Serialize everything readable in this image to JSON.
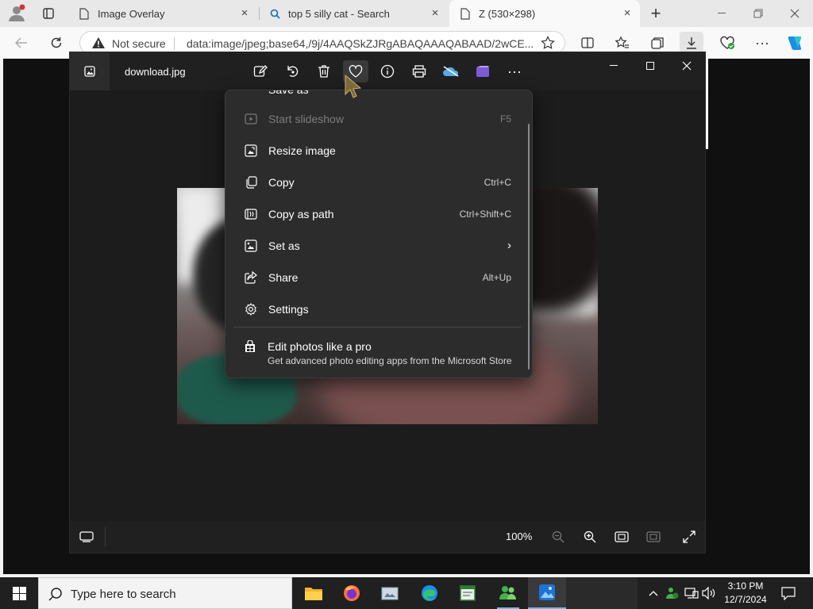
{
  "browser": {
    "tabs": [
      {
        "title": "Image Overlay",
        "icon": "page-icon",
        "active": false
      },
      {
        "title": "top 5 silly cat - Search",
        "icon": "search-icon",
        "active": false
      },
      {
        "title": "Z (530×298)",
        "icon": "page-icon",
        "active": true
      }
    ],
    "new_tab_symbol": "+",
    "address": {
      "security_label": "Not secure",
      "url": "data:image/jpeg;base64,/9j/4AAQSkZJRgABAQAAAQABAAD/2wCE..."
    }
  },
  "photos": {
    "file_name": "download.jpg",
    "toolbar_icons": [
      "edit-icon",
      "rotate-icon",
      "delete-icon",
      "favorite-icon",
      "info-icon",
      "print-icon",
      "onedrive-icon",
      "clipchamp-icon",
      "more-icon"
    ],
    "zoom": "100%",
    "menu": {
      "clipped_item": "Save as",
      "items": [
        {
          "label": "Start slideshow",
          "shortcut": "F5",
          "icon": "slideshow-icon",
          "disabled": true
        },
        {
          "label": "Resize image",
          "shortcut": "",
          "icon": "resize-icon",
          "disabled": false
        },
        {
          "label": "Copy",
          "shortcut": "Ctrl+C",
          "icon": "copy-icon",
          "disabled": false
        },
        {
          "label": "Copy as path",
          "shortcut": "Ctrl+Shift+C",
          "icon": "copy-path-icon",
          "disabled": false
        },
        {
          "label": "Set as",
          "shortcut": "",
          "icon": "set-as-icon",
          "disabled": false,
          "submenu": true
        },
        {
          "label": "Share",
          "shortcut": "Alt+Up",
          "icon": "share-icon",
          "disabled": false
        },
        {
          "label": "Settings",
          "shortcut": "",
          "icon": "settings-icon",
          "disabled": false
        }
      ],
      "promo_title": "Edit photos like a pro",
      "promo_subtitle": "Get advanced photo editing apps from the Microsoft Store"
    }
  },
  "taskbar": {
    "search_placeholder": "Type here to search",
    "time": "3:10 PM",
    "date": "12/7/2024"
  },
  "colors": {
    "accent": "#0f6cbd",
    "photos_bg": "#1c1c1c",
    "menu_bg": "#2c2c2c",
    "taskbar_bg": "#202020"
  }
}
